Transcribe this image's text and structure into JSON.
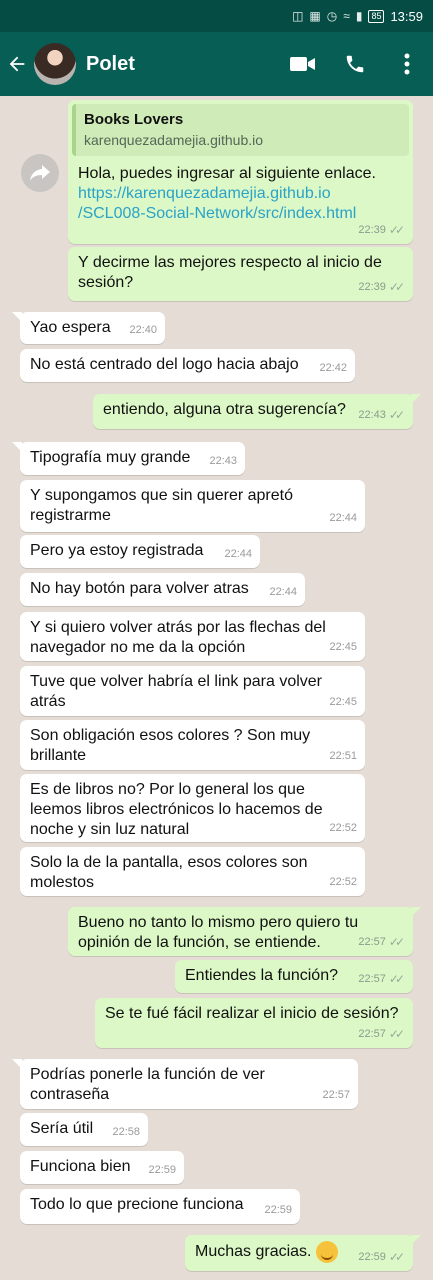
{
  "status_bar": {
    "battery": "85",
    "time": "13:59"
  },
  "header": {
    "contact_name": "Polet"
  },
  "link_preview": {
    "title": "Books Lovers",
    "domain": "karenquezadamejia.github.io"
  },
  "messages": [
    {
      "dir": "out",
      "text": "Hola, puedes ingresar al siguiente enlace.",
      "link": "https://karenquezadamejia.github.io\n/SCL008-Social-Network/src/index.html",
      "time": "22:39"
    },
    {
      "dir": "out",
      "text": "Y decirme las mejores respecto al inicio de sesión?",
      "time": "22:39"
    },
    {
      "dir": "in",
      "text": "Yao espera",
      "time": "22:40"
    },
    {
      "dir": "in",
      "text": "No está centrado del logo hacia abajo",
      "time": "22:42"
    },
    {
      "dir": "out",
      "text": "entiendo, alguna otra sugerencía?",
      "time": "22:43"
    },
    {
      "dir": "in",
      "text": "Tipografía muy grande",
      "time": "22:43"
    },
    {
      "dir": "in",
      "text": "Y supongamos que sin querer apretó\nregistrarme",
      "time": "22:44"
    },
    {
      "dir": "in",
      "text": "Pero ya estoy registrada",
      "time": "22:44"
    },
    {
      "dir": "in",
      "text": "No hay botón para volver atras",
      "time": "22:44"
    },
    {
      "dir": "in",
      "text": "Y si quiero volver atrás por las flechas del\nnavegador no me da la opción",
      "time": "22:45"
    },
    {
      "dir": "in",
      "text": "Tuve que volver habría el link para volver\natrás",
      "time": "22:45"
    },
    {
      "dir": "in",
      "text": "Son obligación esos colores ? Son muy\nbrillante",
      "time": "22:51"
    },
    {
      "dir": "in",
      "text": "Es de libros no? Por lo general los que\nleemos libros electrónicos lo hacemos de\nnoche y sin luz natural",
      "time": "22:52"
    },
    {
      "dir": "in",
      "text": "Solo la de la pantalla, esos colores son\nmolestos",
      "time": "22:52"
    },
    {
      "dir": "out",
      "text": "Bueno no tanto lo mismo pero quiero tu\nopinión de la función, se entiende.",
      "time": "22:57"
    },
    {
      "dir": "out",
      "text": "Entiendes la función?",
      "time": "22:57"
    },
    {
      "dir": "out",
      "text": "Se te fué fácil realizar el inicio de sesión?",
      "time": "22:57"
    },
    {
      "dir": "in",
      "text": "Podrías ponerle la función de ver contraseña",
      "time": "22:57"
    },
    {
      "dir": "in",
      "text": "Sería útil",
      "time": "22:58"
    },
    {
      "dir": "in",
      "text": "Funciona bien",
      "time": "22:59"
    },
    {
      "dir": "in",
      "text": "Todo lo que precione funciona",
      "time": "22:59"
    },
    {
      "dir": "out",
      "text": "Muchas gracias.",
      "emoji": "smiling-face",
      "time": "22:59"
    }
  ]
}
